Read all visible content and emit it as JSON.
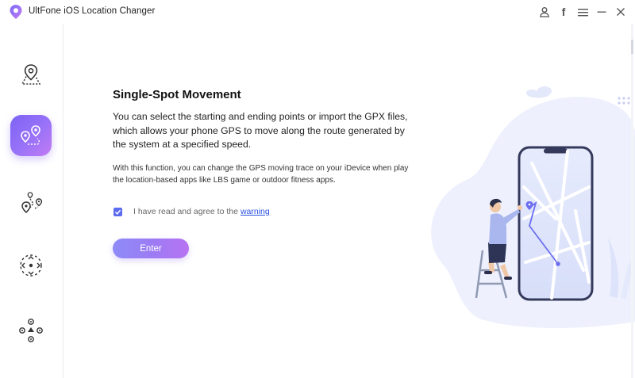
{
  "window": {
    "title": "UltFone iOS Location Changer"
  },
  "titlebar": {
    "icons": [
      "user-icon",
      "facebook-icon",
      "menu-icon",
      "minimize-icon",
      "close-icon"
    ],
    "facebook_glyph": "f"
  },
  "sidebar": {
    "items": [
      {
        "name": "change-location",
        "icon": "map-pin-icon",
        "active": false
      },
      {
        "name": "single-spot-movement",
        "icon": "two-spot-route-icon",
        "active": true
      },
      {
        "name": "multi-spot-movement",
        "icon": "multi-spot-route-icon",
        "active": false
      },
      {
        "name": "joystick-movement",
        "icon": "joystick-icon",
        "active": false
      },
      {
        "name": "pokemon-go",
        "icon": "game-controller-icon",
        "active": false
      }
    ]
  },
  "main": {
    "heading": "Single-Spot Movement",
    "description": "You can select the starting and ending points or import the GPX files, which allows your phone GPS to move along the route generated by the system at a specified speed.",
    "note": "With this function, you can change the GPS moving trace on your iDevice when play the location-based apps like LBS game or outdoor fitness apps.",
    "agree_text": "I have read and agree to the",
    "warning_link": "warning",
    "agree_checked": true,
    "enter_label": "Enter"
  },
  "colors": {
    "accent": "#7c63f4",
    "accent_light": "#c27bf3",
    "link": "#2a4fe0",
    "checkbox": "#5b6cf0",
    "phone_frame": "#353a5c",
    "map_bg": "#dfe5fb"
  }
}
